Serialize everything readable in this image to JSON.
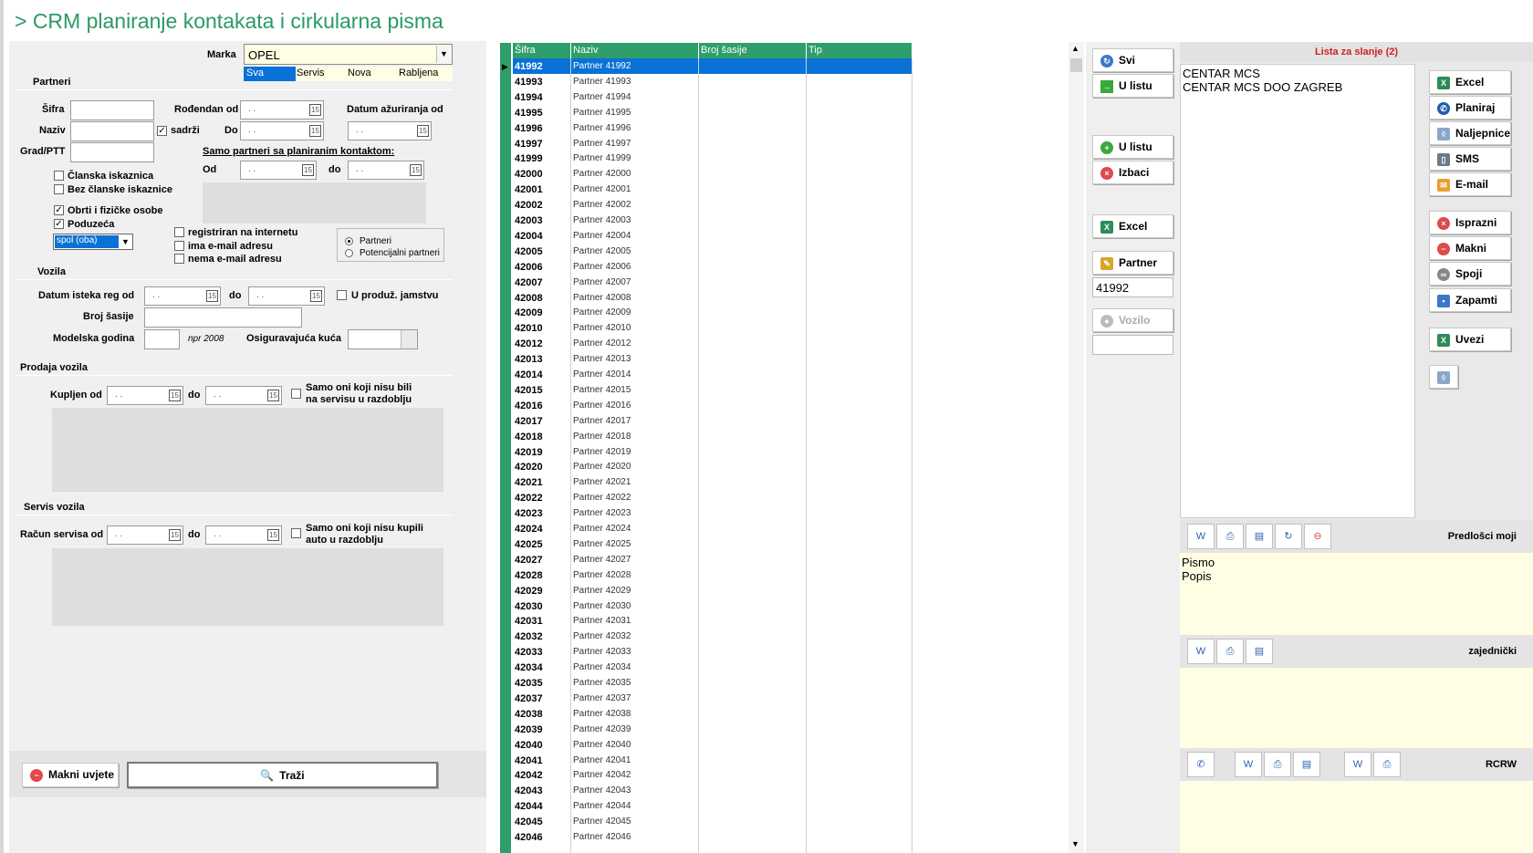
{
  "window": {
    "title": "> CRM planiranje kontakata i cirkularna pisma"
  },
  "filters": {
    "marka_label": "Marka",
    "marka_value": "OPEL",
    "marka_tabs": [
      "Sva",
      "Servis",
      "Nova",
      "Rabljena"
    ],
    "partneri": {
      "section": "Partneri",
      "sifra": "Šifra",
      "naziv": "Naziv",
      "sadrzi": "sadrži",
      "grad": "Grad/PTT",
      "rodjendan_od": "Rođendan od",
      "do": "Do",
      "datum_azuriranja": "Datum ažuriranja od",
      "samo_partneri": "Samo partneri sa planiranim kontaktom:",
      "od": "Od",
      "do_lower": "do",
      "clanska": "Članska iskaznica",
      "bez_clanske": "Bez članske iskaznice",
      "obrti": "Obrti i fizičke osobe",
      "poduzeca": "Poduzeća",
      "spol": "spol (oba)",
      "registriran": "registriran na internetu",
      "ima_email": "ima e-mail adresu",
      "nema_email": "nema e-mail adresu",
      "radio_partneri": "Partneri",
      "radio_potencijalni": "Potencijalni partneri"
    },
    "vozila": {
      "section": "Vozila",
      "datum_isteka": "Datum isteka reg od",
      "do": "do",
      "produz": "U produž. jamstvu",
      "broj_sasije": "Broj šasije",
      "modelska_godina": "Modelska godina",
      "npr": "npr 2008",
      "osiguravajuca": "Osiguravajuća kuća"
    },
    "prodaja": {
      "section": "Prodaja vozila",
      "kupljen_od": "Kupljen od",
      "do": "do",
      "samo_oni": "Samo oni koji nisu bili",
      "samo_oni2": "na servisu u razdoblju"
    },
    "servis": {
      "section": "Servis vozila",
      "racun_od": "Račun servisa od",
      "do": "do",
      "samo_oni": "Samo oni koji nisu kupili",
      "samo_oni2": "auto u razdoblju"
    },
    "date_placeholder": ". .",
    "cal_glyph": "15",
    "makni_uvjete": "Makni uvjete",
    "trazi": "Traži"
  },
  "grid": {
    "headers": [
      "Šifra",
      "Naziv",
      "Broj šasije",
      "Tip"
    ],
    "rows": [
      [
        "41992",
        "Partner 41992"
      ],
      [
        "41993",
        "Partner 41993"
      ],
      [
        "41994",
        "Partner 41994"
      ],
      [
        "41995",
        "Partner 41995"
      ],
      [
        "41996",
        "Partner 41996"
      ],
      [
        "41997",
        "Partner 41997"
      ],
      [
        "41999",
        "Partner 41999"
      ],
      [
        "42000",
        "Partner 42000"
      ],
      [
        "42001",
        "Partner 42001"
      ],
      [
        "42002",
        "Partner 42002"
      ],
      [
        "42003",
        "Partner 42003"
      ],
      [
        "42004",
        "Partner 42004"
      ],
      [
        "42005",
        "Partner 42005"
      ],
      [
        "42006",
        "Partner 42006"
      ],
      [
        "42007",
        "Partner 42007"
      ],
      [
        "42008",
        "Partner 42008"
      ],
      [
        "42009",
        "Partner 42009"
      ],
      [
        "42010",
        "Partner 42010"
      ],
      [
        "42012",
        "Partner 42012"
      ],
      [
        "42013",
        "Partner 42013"
      ],
      [
        "42014",
        "Partner 42014"
      ],
      [
        "42015",
        "Partner 42015"
      ],
      [
        "42016",
        "Partner 42016"
      ],
      [
        "42017",
        "Partner 42017"
      ],
      [
        "42018",
        "Partner 42018"
      ],
      [
        "42019",
        "Partner 42019"
      ],
      [
        "42020",
        "Partner 42020"
      ],
      [
        "42021",
        "Partner 42021"
      ],
      [
        "42022",
        "Partner 42022"
      ],
      [
        "42023",
        "Partner 42023"
      ],
      [
        "42024",
        "Partner 42024"
      ],
      [
        "42025",
        "Partner 42025"
      ],
      [
        "42027",
        "Partner 42027"
      ],
      [
        "42028",
        "Partner 42028"
      ],
      [
        "42029",
        "Partner 42029"
      ],
      [
        "42030",
        "Partner 42030"
      ],
      [
        "42031",
        "Partner 42031"
      ],
      [
        "42032",
        "Partner 42032"
      ],
      [
        "42033",
        "Partner 42033"
      ],
      [
        "42034",
        "Partner 42034"
      ],
      [
        "42035",
        "Partner 42035"
      ],
      [
        "42037",
        "Partner 42037"
      ],
      [
        "42038",
        "Partner 42038"
      ],
      [
        "42039",
        "Partner 42039"
      ],
      [
        "42040",
        "Partner 42040"
      ],
      [
        "42041",
        "Partner 42041"
      ],
      [
        "42042",
        "Partner 42042"
      ],
      [
        "42043",
        "Partner 42043"
      ],
      [
        "42044",
        "Partner 42044"
      ],
      [
        "42045",
        "Partner 42045"
      ],
      [
        "42046",
        "Partner 42046"
      ]
    ]
  },
  "actions": {
    "svi": "Svi",
    "u_listu": "U listu",
    "u_listu2": "U listu",
    "izbaci": "Izbaci",
    "excel": "Excel",
    "partner": "Partner",
    "partner_value": "41992",
    "vozilo": "Vozilo"
  },
  "send_list": {
    "title": "Lista za slanje (2)",
    "items": [
      "CENTAR MCS",
      "CENTAR MCS DOO ZAGREB"
    ],
    "buttons": [
      "Excel",
      "Planiraj",
      "Naljepnice",
      "SMS",
      "E-mail",
      "Isprazni",
      "Makni",
      "Spoji",
      "Zapamti",
      "Uvezi"
    ]
  },
  "templates": {
    "moji_label": "Predlošci moji",
    "moji_items": [
      "Pismo",
      "Popis"
    ],
    "zajednicki_label": "zajednički",
    "rcrw_label": "RCRW"
  },
  "colors": {
    "accent": "#2e9e6a",
    "selection": "#0a72d6",
    "title": "#2a9a63"
  }
}
